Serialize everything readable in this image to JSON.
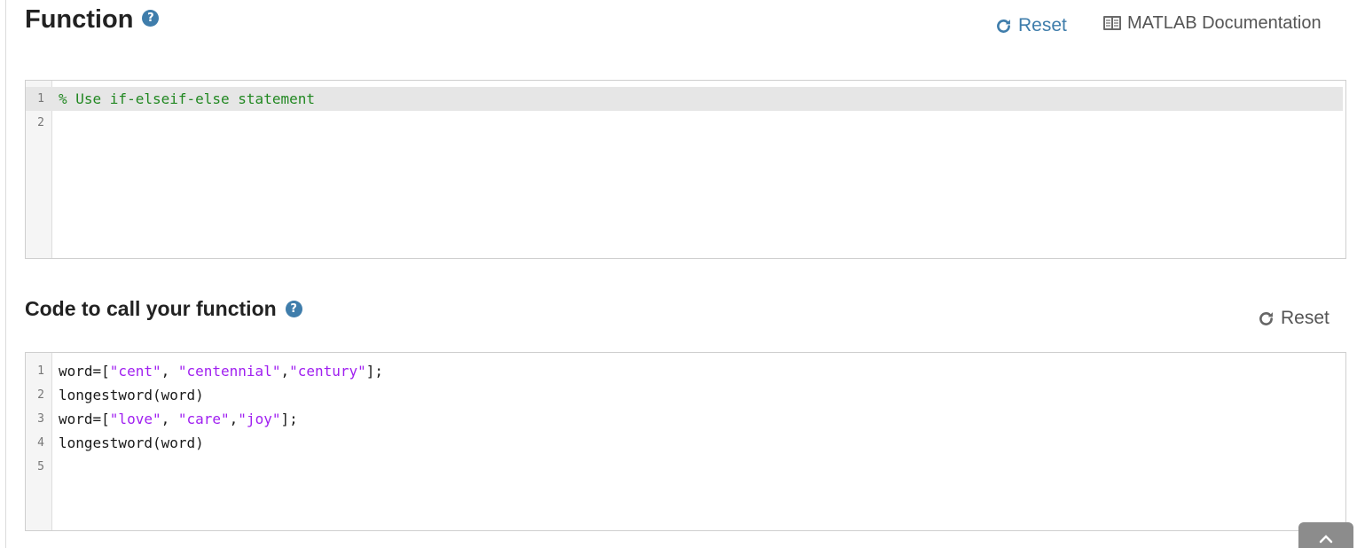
{
  "function_section": {
    "title": "Function",
    "reset_label": "Reset",
    "docs_label": "MATLAB Documentation",
    "code_lines": [
      {
        "num": "1",
        "segments": [
          {
            "t": "comment",
            "v": "% Use if-elseif-else statement"
          }
        ]
      },
      {
        "num": "2",
        "segments": []
      }
    ]
  },
  "call_section": {
    "title": "Code to call your function",
    "reset_label": "Reset",
    "code_lines": [
      {
        "num": "1",
        "segments": [
          {
            "t": "plain",
            "v": "word=["
          },
          {
            "t": "str",
            "v": "\"cent\""
          },
          {
            "t": "plain",
            "v": ", "
          },
          {
            "t": "str",
            "v": "\"centennial\""
          },
          {
            "t": "plain",
            "v": ","
          },
          {
            "t": "str",
            "v": "\"century\""
          },
          {
            "t": "plain",
            "v": "];"
          }
        ]
      },
      {
        "num": "2",
        "segments": [
          {
            "t": "plain",
            "v": "longestword(word)"
          }
        ]
      },
      {
        "num": "3",
        "segments": [
          {
            "t": "plain",
            "v": "word=["
          },
          {
            "t": "str",
            "v": "\"love\""
          },
          {
            "t": "plain",
            "v": ", "
          },
          {
            "t": "str",
            "v": "\"care\""
          },
          {
            "t": "plain",
            "v": ","
          },
          {
            "t": "str",
            "v": "\"joy\""
          },
          {
            "t": "plain",
            "v": "];"
          }
        ]
      },
      {
        "num": "4",
        "segments": [
          {
            "t": "plain",
            "v": "longestword(word)"
          }
        ]
      },
      {
        "num": "5",
        "segments": []
      }
    ]
  },
  "icons": {
    "help": "help-circle-icon",
    "reset": "refresh-icon",
    "docs": "open-book-icon",
    "scroll_top": "chevron-up-icon"
  },
  "colors": {
    "accent": "#3f7dab",
    "comment": "#228822",
    "string": "#a020f0",
    "active_line": "#e6e6e6"
  }
}
